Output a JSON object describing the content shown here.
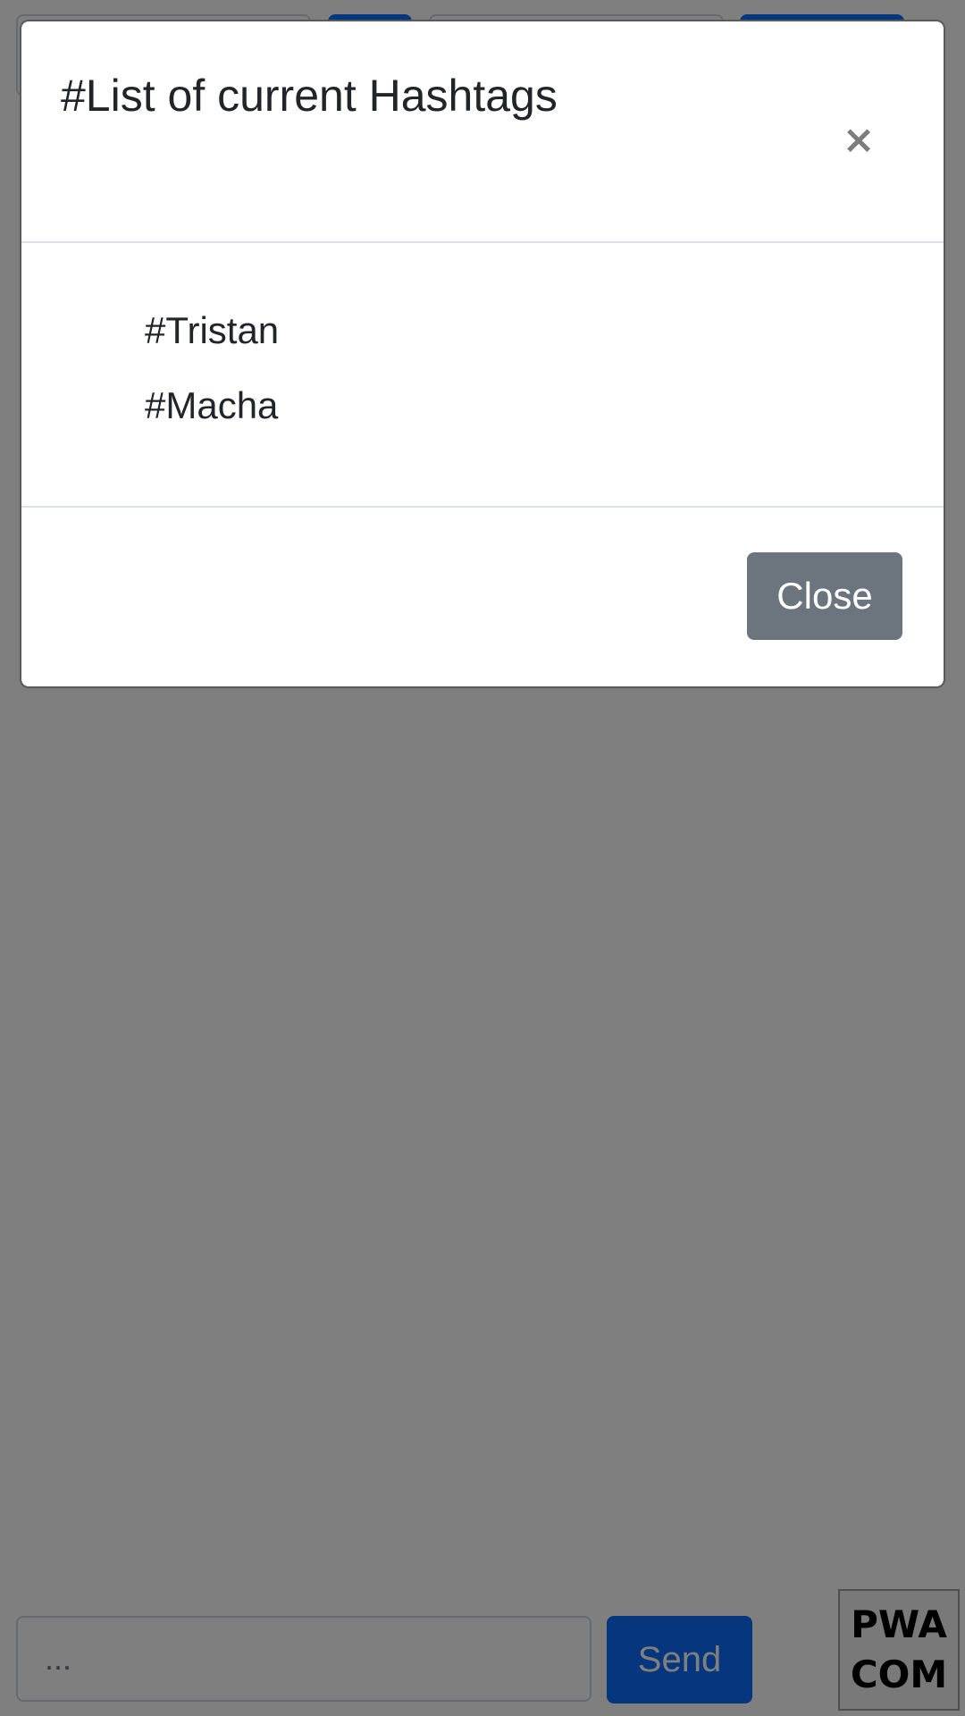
{
  "modal": {
    "title": "#List of current Hashtags",
    "close_icon": "×",
    "hashtags": [
      "#Tristan",
      "#Macha"
    ],
    "close_button_label": "Close"
  },
  "composer": {
    "placeholder": "...",
    "send_label": "Send"
  },
  "logo": {
    "line1": "PWA",
    "line2": "COM"
  },
  "colors": {
    "primary": "#0d6efd",
    "secondary": "#6c757d",
    "backdrop": "rgba(0,0,0,0.5)"
  }
}
